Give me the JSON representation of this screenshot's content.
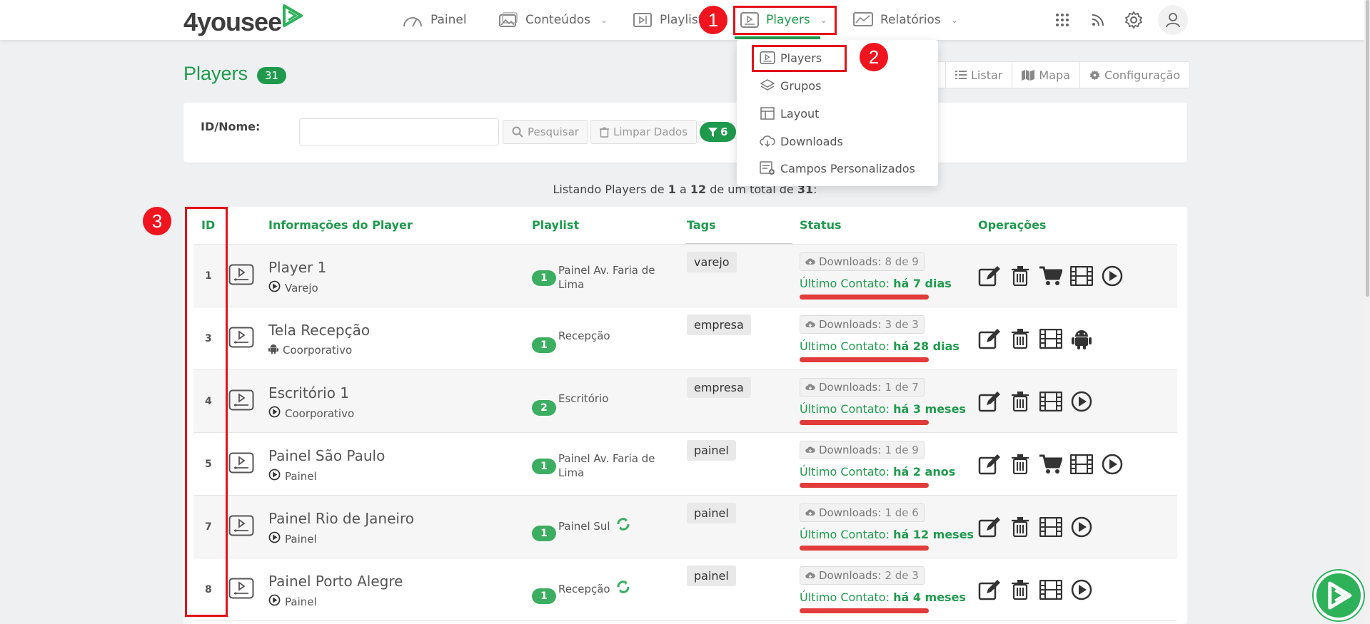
{
  "header": {
    "logo_text": "4yousee",
    "nav": [
      {
        "label": "Painel",
        "icon": "gauge-icon"
      },
      {
        "label": "Conteúdos",
        "icon": "images-icon"
      },
      {
        "label": "Playlist",
        "icon": "playlist-icon"
      },
      {
        "label": "Players",
        "icon": "player-screen-icon",
        "active": true
      },
      {
        "label": "Relatórios",
        "icon": "chart-icon"
      }
    ],
    "right_icons": [
      "apps-grid-icon",
      "rss-icon",
      "gear-icon",
      "user-icon"
    ]
  },
  "annotations": [
    "1",
    "2",
    "3"
  ],
  "dropdown": {
    "items": [
      {
        "label": "Players",
        "icon": "player-screen-icon"
      },
      {
        "label": "Grupos",
        "icon": "layers-icon"
      },
      {
        "label": "Layout",
        "icon": "layout-icon"
      },
      {
        "label": "Downloads",
        "icon": "cloud-download-icon"
      },
      {
        "label": "Campos Personalizados",
        "icon": "custom-fields-icon"
      }
    ]
  },
  "page": {
    "title": "Players",
    "count": "31",
    "views": [
      {
        "label": "Listar",
        "icon": "list-icon"
      },
      {
        "label": "Mapa",
        "icon": "map-icon"
      },
      {
        "label": "Configuração",
        "icon": "gear-icon"
      }
    ]
  },
  "filter": {
    "label": "ID/Nome:",
    "input_value": "",
    "search_label": "Pesquisar",
    "clear_label": "Limpar Dados",
    "filter_count": "6"
  },
  "listing": {
    "prefix": "Listando Players de ",
    "from": "1",
    "mid1": " a ",
    "to": "12",
    "mid2": " de um total de ",
    "total": "31",
    "suffix": ":"
  },
  "table": {
    "headers": [
      "ID",
      "Informações do Player",
      "Playlist",
      "Tags",
      "Status",
      "Operações"
    ],
    "download_prefix": "Downloads:",
    "contact_prefix": "Último Contato:",
    "rows": [
      {
        "id": "1",
        "name": "Player 1",
        "type": "Varejo",
        "type_icon": "play-circle-icon",
        "playlist_count": "1",
        "playlist": "Painel Av. Faria de Lima",
        "sync": false,
        "tag": "varejo",
        "downloads": "8 de 9",
        "contact": "há 7 dias",
        "ops": [
          "edit-icon",
          "trash-icon",
          "cart-icon",
          "film-icon",
          "play-circle-icon"
        ]
      },
      {
        "id": "3",
        "name": "Tela Recepção",
        "type": "Coorporativo",
        "type_icon": "android-icon",
        "playlist_count": "1",
        "playlist": "Recepção",
        "sync": false,
        "tag": "empresa",
        "downloads": "3 de 3",
        "contact": "há 28 dias",
        "ops": [
          "edit-icon",
          "trash-icon",
          "film-icon",
          "android-icon"
        ]
      },
      {
        "id": "4",
        "name": "Escritório 1",
        "type": "Coorporativo",
        "type_icon": "play-circle-icon",
        "playlist_count": "2",
        "playlist": "Escritório",
        "sync": false,
        "tag": "empresa",
        "downloads": "1 de 7",
        "contact": "há 3 meses",
        "ops": [
          "edit-icon",
          "trash-icon",
          "film-icon",
          "play-circle-icon"
        ]
      },
      {
        "id": "5",
        "name": "Painel São Paulo",
        "type": "Painel",
        "type_icon": "play-circle-icon",
        "playlist_count": "1",
        "playlist": "Painel Av. Faria de Lima",
        "sync": false,
        "tag": "painel",
        "downloads": "1 de 9",
        "contact": "há 2 anos",
        "ops": [
          "edit-icon",
          "trash-icon",
          "cart-icon",
          "film-icon",
          "play-circle-icon"
        ]
      },
      {
        "id": "7",
        "name": "Painel Rio de Janeiro",
        "type": "Painel",
        "type_icon": "play-circle-icon",
        "playlist_count": "1",
        "playlist": "Painel Sul",
        "sync": true,
        "tag": "painel",
        "downloads": "1 de 6",
        "contact": "há 12 meses",
        "ops": [
          "edit-icon",
          "trash-icon",
          "film-icon",
          "play-circle-icon"
        ]
      },
      {
        "id": "8",
        "name": "Painel Porto Alegre",
        "type": "Painel",
        "type_icon": "play-circle-icon",
        "playlist_count": "1",
        "playlist": "Recepção",
        "sync": true,
        "tag": "painel",
        "downloads": "2 de 3",
        "contact": "há 4 meses",
        "ops": [
          "edit-icon",
          "trash-icon",
          "film-icon",
          "play-circle-icon"
        ]
      }
    ]
  },
  "colors": {
    "brand_green": "#1f9a4d",
    "annotation_red": "#e3121a",
    "contact_bar": "#e23b3b"
  }
}
